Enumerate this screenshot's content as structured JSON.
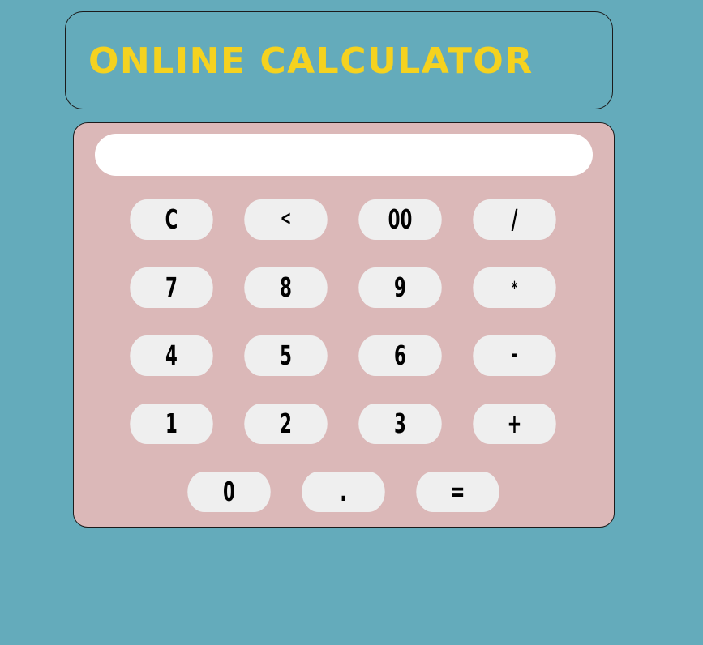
{
  "header": {
    "title": "ONLINE CALCULATOR"
  },
  "display": {
    "value": ""
  },
  "keys": {
    "clear": "C",
    "backspace": "<",
    "double_zero": "00",
    "divide": "/",
    "seven": "7",
    "eight": "8",
    "nine": "9",
    "multiply": "*",
    "four": "4",
    "five": "5",
    "six": "6",
    "subtract": "-",
    "one": "1",
    "two": "2",
    "three": "3",
    "add": "+",
    "zero": "0",
    "decimal": ".",
    "equals": "="
  },
  "colors": {
    "background": "#64abbb",
    "title": "#f5d21f",
    "calculator_body": "#dbb8b8",
    "key": "#efefef",
    "display": "#ffffff"
  }
}
